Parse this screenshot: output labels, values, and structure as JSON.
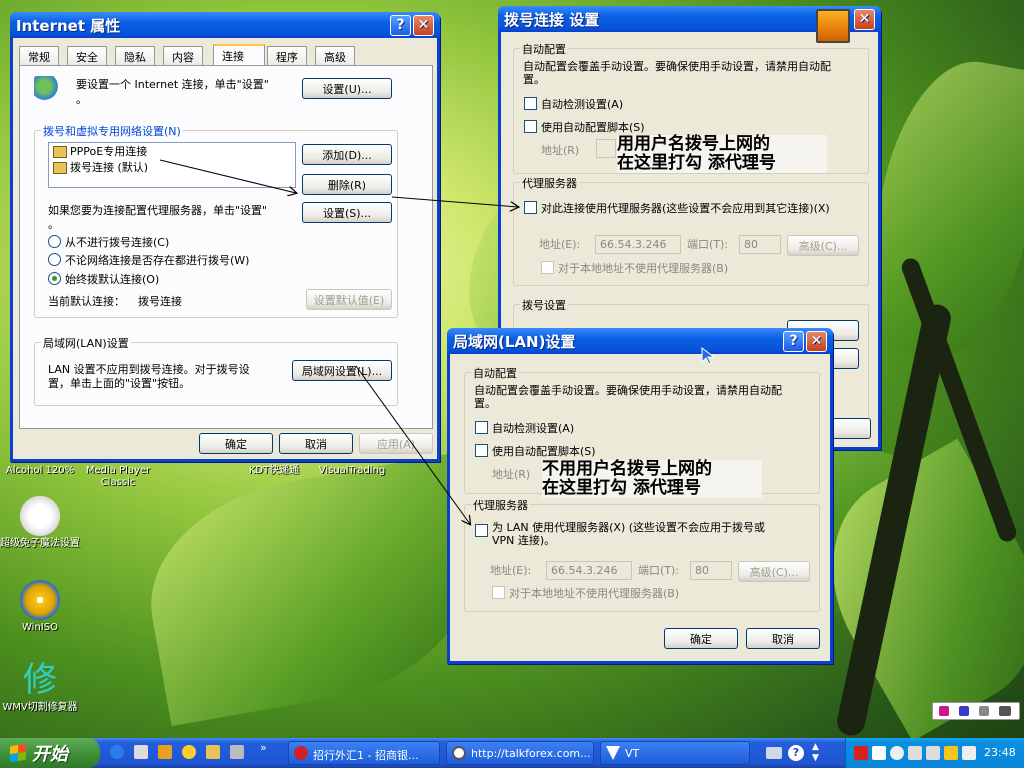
{
  "colors": {
    "title_bar": "#0a5fe6",
    "group_label": "#0046d5",
    "taskbar": "#245edb",
    "start_button": "#3c8b35"
  },
  "desktop": {
    "icons": [
      {
        "label": "Alcohol 120%"
      },
      {
        "label": "Media Player Classic"
      },
      {
        "label": "KDT快递通"
      },
      {
        "label": "VisualTrading"
      },
      {
        "label": "超级兔子魔法设置"
      },
      {
        "label": "WinISO"
      },
      {
        "label": "WMV切割修复器"
      }
    ]
  },
  "internet_props": {
    "title": "Internet 属性",
    "tabs": [
      "常规",
      "安全",
      "隐私",
      "内容",
      "连接",
      "程序",
      "高级"
    ],
    "setup_text": "要设置一个 Internet 连接，单击\"设置\"",
    "setup_dot": "。",
    "setup_btn": "设置(U)...",
    "dialup_group": "拨号和虚拟专用网络设置(N)",
    "connections": [
      "PPPoE专用连接",
      "拨号连接 (默认)"
    ],
    "add_btn": "添加(D)...",
    "delete_btn": "删除(R)",
    "proxy_text": "如果您要为连接配置代理服务器，单击\"设置\"",
    "proxy_dot": "。",
    "settings_btn": "设置(S)...",
    "radio_options": [
      "从不进行拨号连接(C)",
      "不论网络连接是否存在都进行拨号(W)",
      "始终拨默认连接(O)"
    ],
    "current_default_label": "当前默认连接：",
    "current_default_value": "拨号连接",
    "set_default_btn": "设置默认值(E)",
    "lan_group": "局域网(LAN)设置",
    "lan_text_1": "LAN 设置不应用到拨号连接。对于拨号设",
    "lan_text_2": "置，单击上面的\"设置\"按钮。",
    "lan_btn": "局域网设置(L)...",
    "ok": "确定",
    "cancel": "取消",
    "apply": "应用(A)"
  },
  "dialup_settings": {
    "title": "拨号连接 设置",
    "auto_group": "自动配置",
    "auto_text_1": "自动配置会覆盖手动设置。要确保使用手动设置，请禁用自动配",
    "auto_text_2": "置。",
    "auto_detect": "自动检测设置(A)",
    "auto_script": "使用自动配置脚本(S)",
    "address_label": "地址(R)",
    "proxy_group": "代理服务器",
    "proxy_check": "对此连接使用代理服务器(这些设置不会应用到其它连接)(X)",
    "address_field_label": "地址(E):",
    "address_value": "66.54.3.246",
    "port_label": "端口(T):",
    "port_value": "80",
    "advanced_btn": "高级(C)...",
    "bypass_local": "对于本地地址不使用代理服务器(B)",
    "dialing_group": "拨号设置",
    "annotation_1": "用用户名拨号上网的",
    "annotation_2": "在这里打勾 添代理号"
  },
  "lan_settings": {
    "title": "局域网(LAN)设置",
    "auto_group": "自动配置",
    "auto_text_1": "自动配置会覆盖手动设置。要确保使用手动设置，请禁用自动配",
    "auto_text_2": "置。",
    "auto_detect": "自动检测设置(A)",
    "auto_script": "使用自动配置脚本(S)",
    "address_label": "地址(R)",
    "proxy_group": "代理服务器",
    "proxy_check_1": "为 LAN 使用代理服务器(X) (这些设置不会应用于拨号或",
    "proxy_check_2": "VPN 连接)。",
    "address_field_label": "地址(E):",
    "address_value": "66.54.3.246",
    "port_label": "端口(T):",
    "port_value": "80",
    "advanced_btn": "高级(C)...",
    "bypass_local": "对于本地地址不使用代理服务器(B)",
    "ok": "确定",
    "cancel": "取消",
    "annotation_1": "不用用户名拨号上网的",
    "annotation_2": "在这里打勾 添代理号"
  },
  "taskbar": {
    "start": "开始",
    "tasks": [
      "招行外汇1 - 招商银...",
      "http://talkforex.com...",
      "VT"
    ],
    "clock": "23:48"
  }
}
